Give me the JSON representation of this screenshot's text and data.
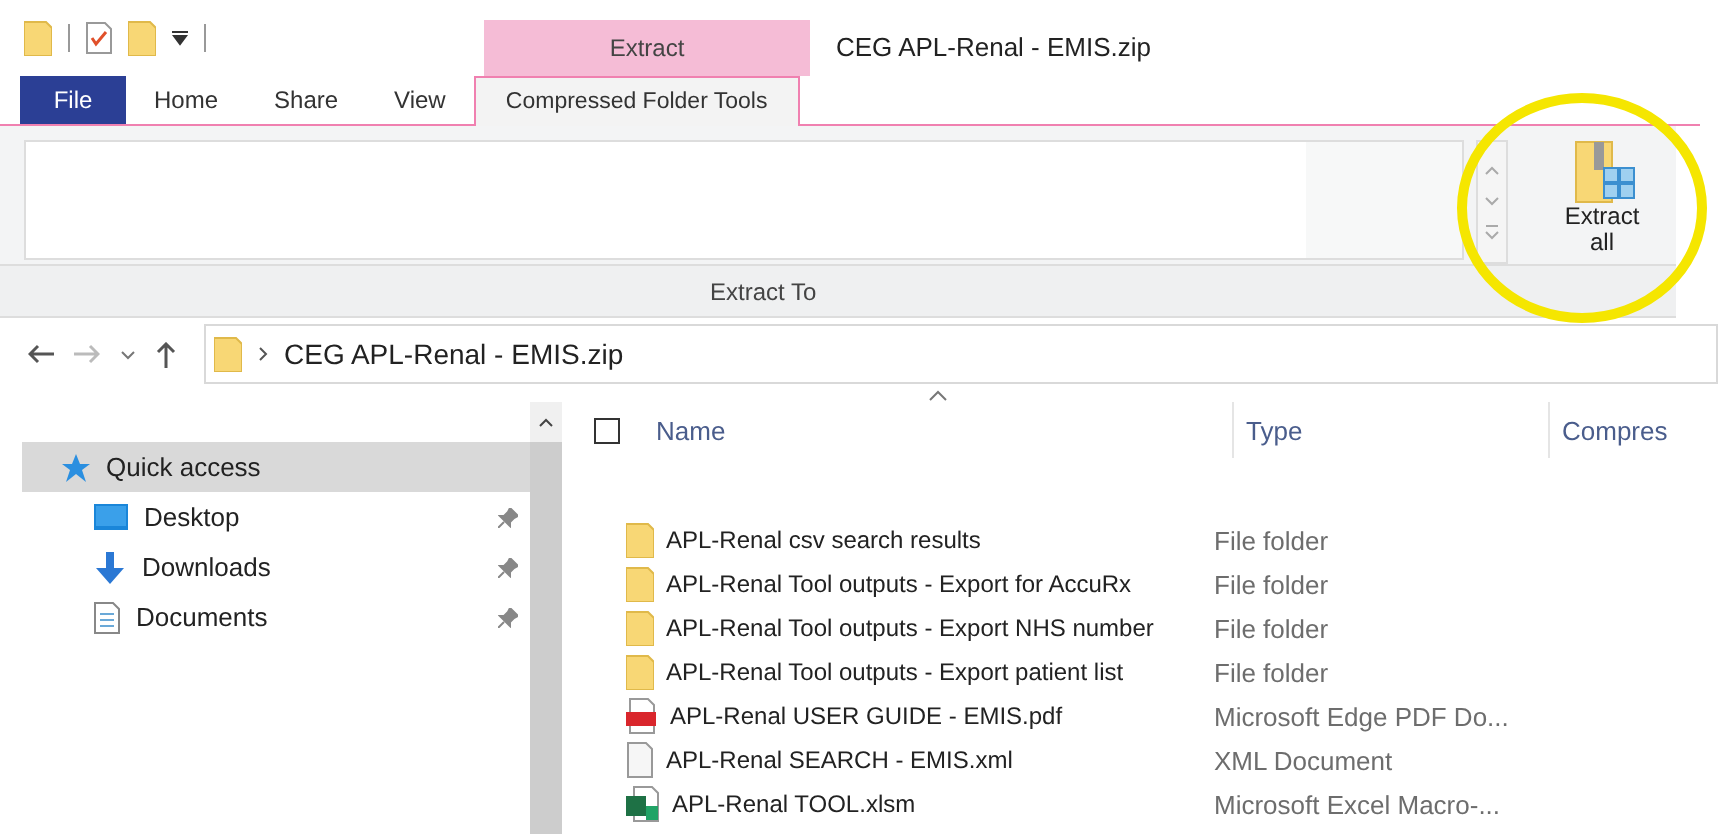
{
  "window": {
    "title": "CEG APL-Renal - EMIS.zip"
  },
  "context_tab_header": "Extract",
  "tabs": [
    {
      "label": "File",
      "kind": "file",
      "selected": false
    },
    {
      "label": "Home",
      "kind": "normal",
      "selected": false
    },
    {
      "label": "Share",
      "kind": "normal",
      "selected": false
    },
    {
      "label": "View",
      "kind": "normal",
      "selected": false
    },
    {
      "label": "Compressed Folder Tools",
      "kind": "context",
      "selected": true
    }
  ],
  "ribbon": {
    "group_label": "Extract To",
    "button": "Extract\nall"
  },
  "address": {
    "path": "CEG APL-Renal - EMIS.zip"
  },
  "sidebar": {
    "items": [
      {
        "label": "Quick access",
        "kind": "star",
        "selected": true,
        "pinned": false
      },
      {
        "label": "Desktop",
        "kind": "desktop",
        "selected": false,
        "pinned": true
      },
      {
        "label": "Downloads",
        "kind": "download",
        "selected": false,
        "pinned": true
      },
      {
        "label": "Documents",
        "kind": "documents",
        "selected": false,
        "pinned": true
      }
    ]
  },
  "table": {
    "select_all_checked": false,
    "columns": [
      "Name",
      "Type",
      "Compres"
    ],
    "rows": [
      {
        "name": "APL-Renal csv search results",
        "type": "File folder",
        "kind": "folder"
      },
      {
        "name": "APL-Renal Tool outputs - Export for AccuRx",
        "type": "File folder",
        "kind": "folder"
      },
      {
        "name": "APL-Renal Tool outputs - Export NHS number",
        "type": "File folder",
        "kind": "folder"
      },
      {
        "name": "APL-Renal Tool outputs - Export patient list",
        "type": "File folder",
        "kind": "folder"
      },
      {
        "name": "APL-Renal USER GUIDE - EMIS.pdf",
        "type": "Microsoft Edge PDF Do...",
        "kind": "pdf"
      },
      {
        "name": "APL-Renal SEARCH - EMIS.xml",
        "type": "XML Document",
        "kind": "xml"
      },
      {
        "name": "APL-Renal TOOL.xlsm",
        "type": "Microsoft Excel Macro-...",
        "kind": "excel"
      }
    ]
  }
}
